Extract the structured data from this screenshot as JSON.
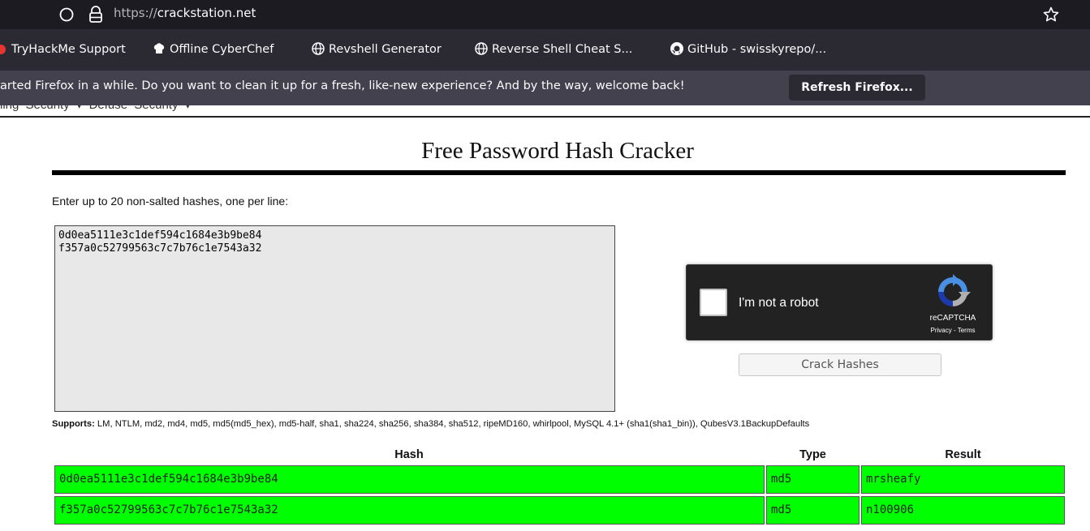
{
  "browser": {
    "url_scheme": "https://",
    "url_host": "crackstation.net",
    "bookmarks": [
      {
        "label": "TryHackMe Support",
        "icon": "tryhackme-icon"
      },
      {
        "label": "Offline CyberChef",
        "icon": "chef-hat-icon"
      },
      {
        "label": "Revshell Generator",
        "icon": "globe-icon"
      },
      {
        "label": "Reverse Shell Cheat S...",
        "icon": "globe-icon"
      },
      {
        "label": "GitHub - swisskyrepo/...",
        "icon": "github-icon"
      }
    ],
    "notification": {
      "text": "arted Firefox in a while. Do you want to clean it up for a fresh, like-new experience? And by the way, welcome back!",
      "button": "Refresh Firefox..."
    }
  },
  "page": {
    "cropped_nav": "ling Security   ▾   Defuse Security   ▾",
    "title": "Free Password Hash Cracker",
    "instructions": "Enter up to 20 non-salted hashes, one per line:",
    "input_value": "0d0ea5111e3c1def594c1684e3b9be84\nf357a0c52799563c7c7b76c1e7543a32",
    "recaptcha": {
      "label": "I'm not a robot",
      "brand": "reCAPTCHA",
      "privacy": "Privacy",
      "separator": " - ",
      "terms": "Terms"
    },
    "crack_button": "Crack Hashes",
    "supports_label": "Supports:",
    "supports_list": " LM, NTLM, md2, md4, md5, md5(md5_hex), md5-half, sha1, sha224, sha256, sha384, sha512, ripeMD160, whirlpool, MySQL 4.1+ (sha1(sha1_bin)), QubesV3.1BackupDefaults"
  },
  "results": {
    "headers": {
      "hash": "Hash",
      "type": "Type",
      "result": "Result"
    },
    "rows": [
      {
        "hash": "0d0ea5111e3c1def594c1684e3b9be84",
        "type": "md5",
        "result": "mrsheafy"
      },
      {
        "hash": "f357a0c52799563c7c7b76c1e7543a32",
        "type": "md5",
        "result": "n100906"
      }
    ],
    "status_color": "#00ff00"
  }
}
